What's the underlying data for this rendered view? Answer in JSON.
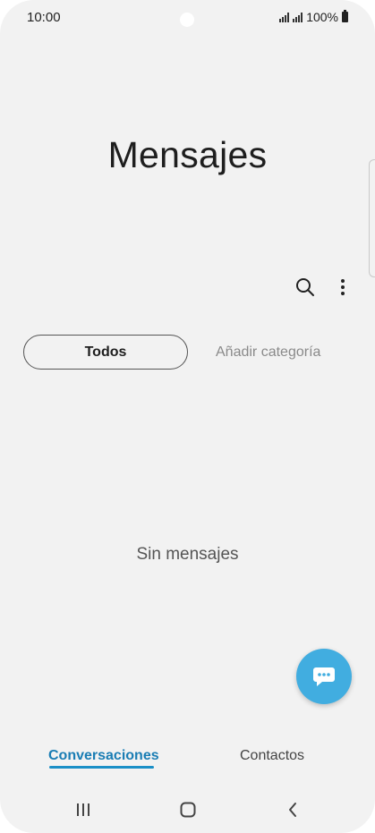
{
  "status_bar": {
    "time": "10:00",
    "battery": "100%"
  },
  "header": {
    "title": "Mensajes"
  },
  "filters": {
    "all_label": "Todos",
    "add_category_label": "Añadir categoría"
  },
  "main": {
    "empty_text": "Sin mensajes"
  },
  "bottom_tabs": [
    {
      "label": "Conversaciones",
      "selected": true
    },
    {
      "label": "Contactos",
      "selected": false
    }
  ],
  "icons": {
    "search": "search-icon",
    "more": "more-vertical-icon",
    "compose": "chat-bubble-icon",
    "nav_recent": "recent-apps-icon",
    "nav_home": "home-icon",
    "nav_back": "back-icon"
  },
  "colors": {
    "accent": "#41ade0",
    "selected_tab": "#1a7db4",
    "background": "#f2f2f2"
  }
}
